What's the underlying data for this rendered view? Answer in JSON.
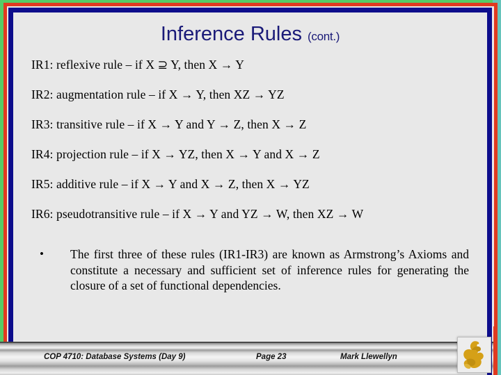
{
  "slide": {
    "title_main": "Inference Rules",
    "title_suffix": "(cont.)",
    "title_color": "#1a1a78",
    "background_color": "#e8e8e8"
  },
  "frame": {
    "outer_color": "#55cc66",
    "mid_color": "#e03a20",
    "inner_color": "#0d0d8c",
    "accent_color": "#66c4bb"
  },
  "rules": [
    {
      "id": "IR1",
      "text": "IR1:  reflexive rule – if X ⊇ Y, then X → Y"
    },
    {
      "id": "IR2",
      "text": "IR2: augmentation rule – if X → Y, then XZ → YZ"
    },
    {
      "id": "IR3",
      "text": "IR3: transitive rule – if X → Y and Y → Z, then X → Z"
    },
    {
      "id": "IR4",
      "text": "IR4: projection rule – if X → YZ, then X → Y and X → Z"
    },
    {
      "id": "IR5",
      "text": "IR5: additive rule – if X → Y and X → Z, then X → YZ"
    },
    {
      "id": "IR6",
      "text": "IR6: pseudotransitive rule – if X → Y and YZ → W, then XZ → W"
    }
  ],
  "bullet": {
    "marker": "•",
    "text": "The first three of these rules (IR1-IR3) are known as Armstrong’s Axioms and constitute a necessary and sufficient set of inference rules for generating the closure of a set of functional dependencies."
  },
  "footer": {
    "course": "COP 4710: Database Systems  (Day 9)",
    "page": "Page 23",
    "author": "Mark Llewellyn"
  },
  "logo": {
    "name": "pegasus-logo",
    "color": "#d5a017"
  }
}
